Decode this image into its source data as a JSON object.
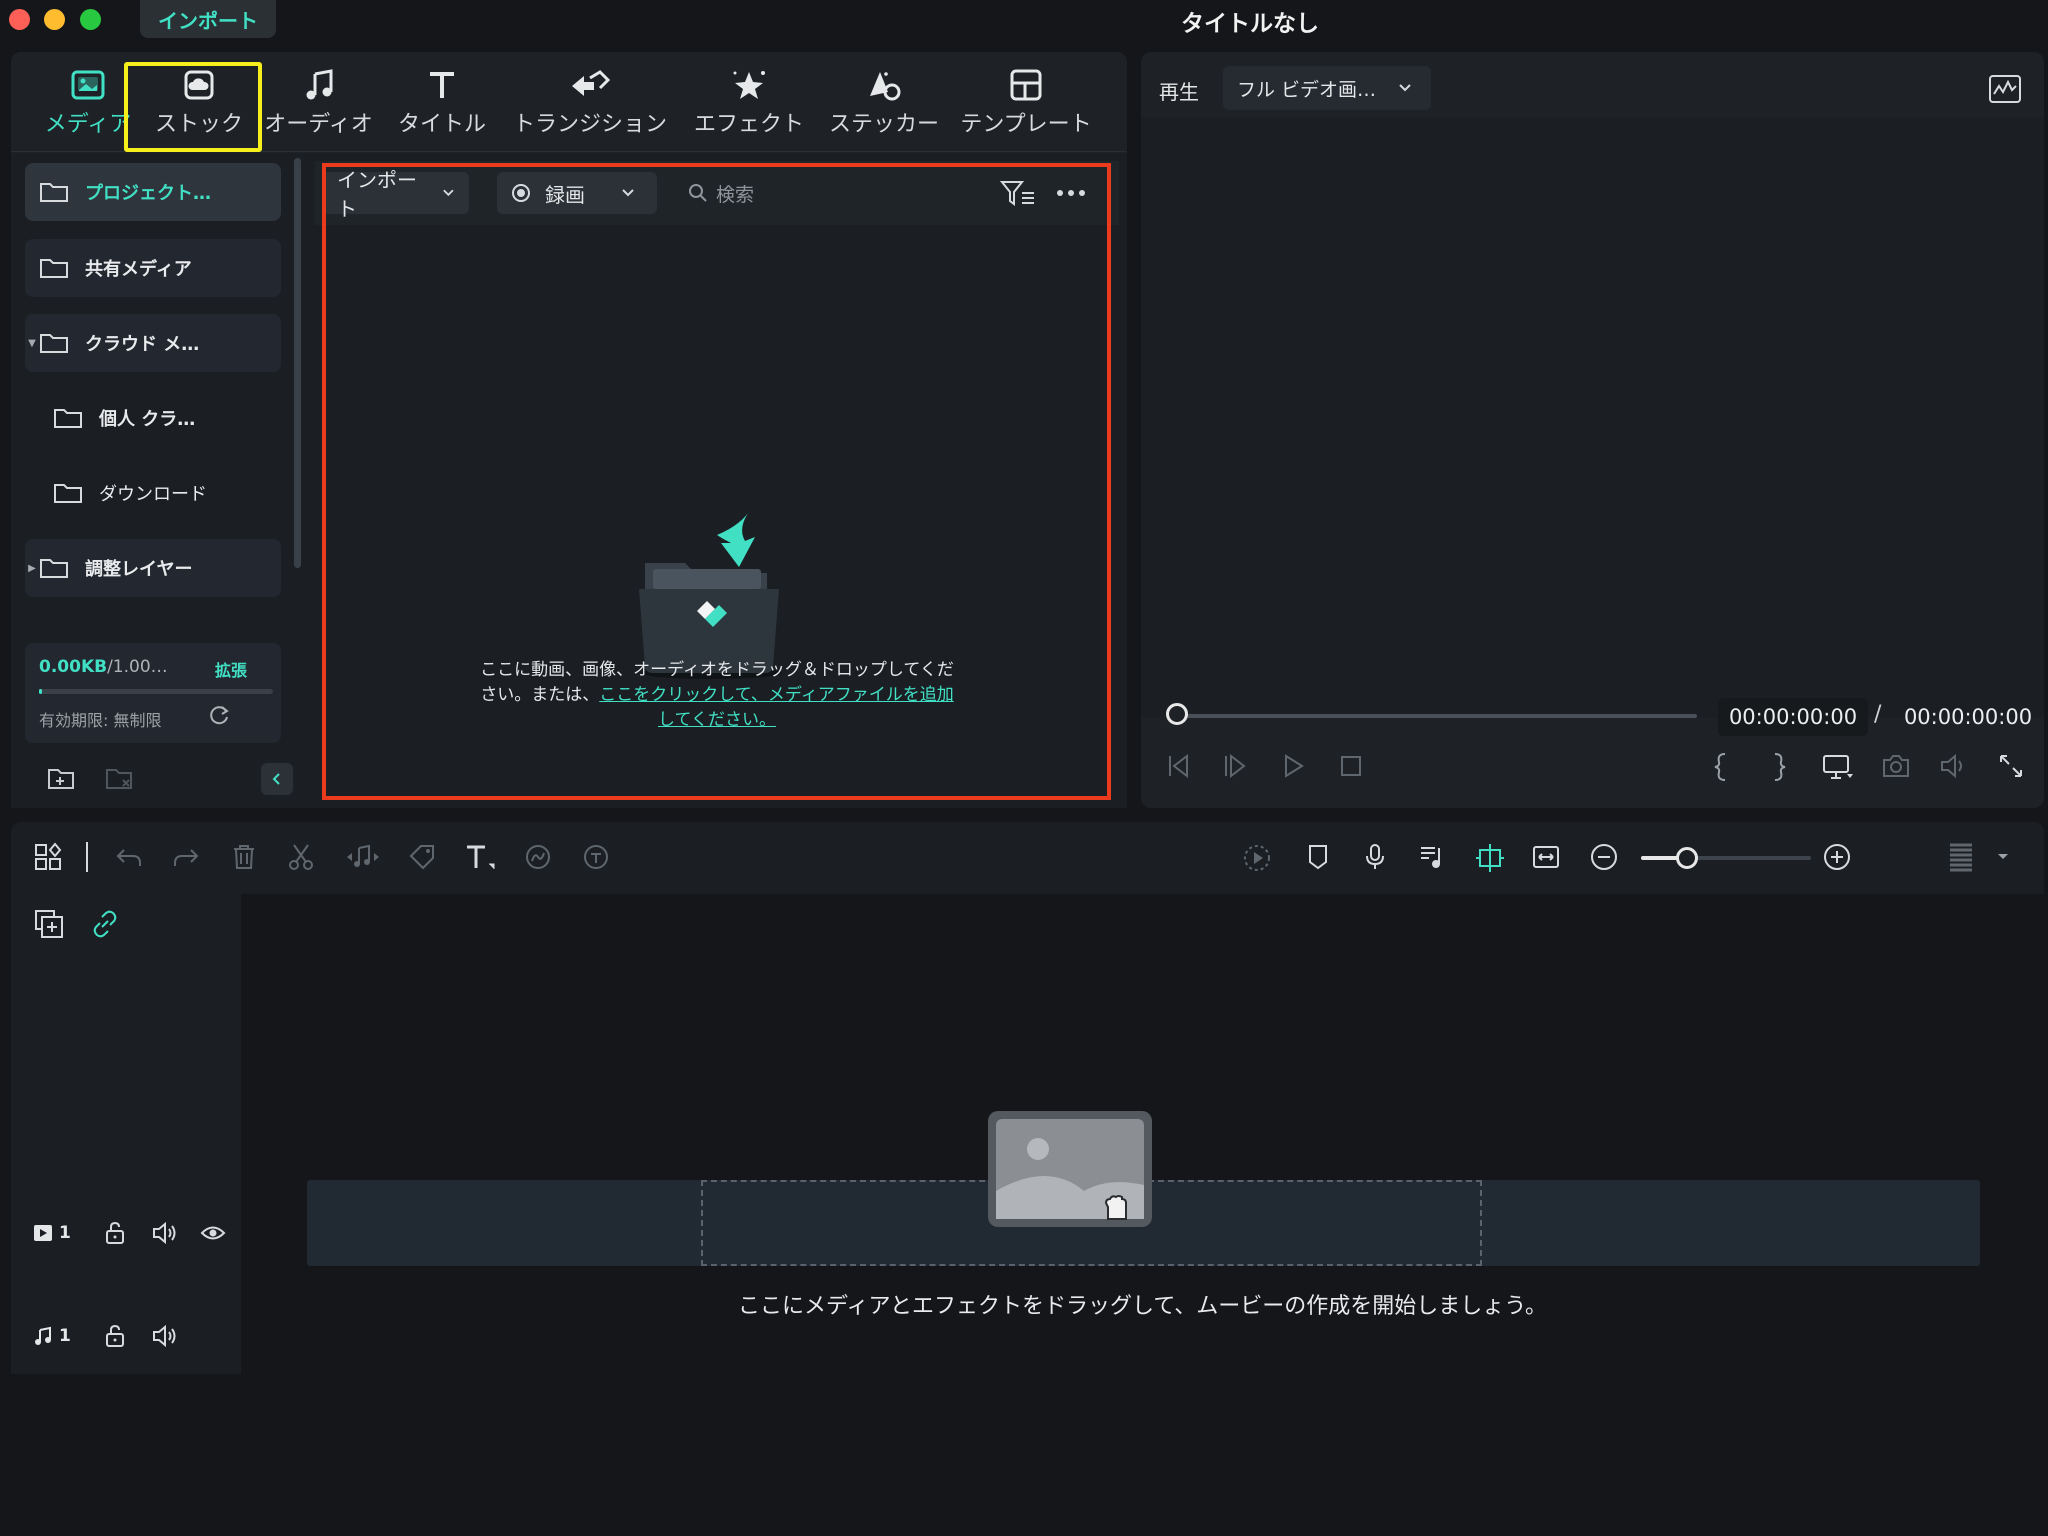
{
  "app": {
    "window_title": "タイトルなし",
    "active_top_tab": "インポート"
  },
  "library_tabs": [
    {
      "label": "メディア",
      "icon": "media-icon",
      "active": true
    },
    {
      "label": "ストック",
      "icon": "stock-cloud-icon",
      "active": false,
      "highlighted": true
    },
    {
      "label": "オーディオ",
      "icon": "music-note-icon",
      "active": false
    },
    {
      "label": "タイトル",
      "icon": "title-t-icon",
      "active": false
    },
    {
      "label": "トランジション",
      "icon": "transition-icon",
      "active": false
    },
    {
      "label": "エフェクト",
      "icon": "effect-star-icon",
      "active": false
    },
    {
      "label": "ステッカー",
      "icon": "sticker-icon",
      "active": false
    },
    {
      "label": "テンプレート",
      "icon": "template-icon",
      "active": false
    }
  ],
  "sidebar": {
    "items": [
      {
        "label": "プロジェクト…",
        "active": true
      },
      {
        "label": "共有メディア"
      },
      {
        "label": "クラウド メ…",
        "expanded": true
      },
      {
        "label": "個人 クラ…",
        "child": true
      },
      {
        "label": "ダウンロード",
        "child": true
      },
      {
        "label": "調整レイヤー",
        "collapsed": true
      }
    ],
    "storage": {
      "used": "0.00KB",
      "total": "/1.00…",
      "expand": "拡張",
      "expiry": "有効期限: 無制限",
      "fill_fraction": 0.01
    }
  },
  "media": {
    "import_label": "インポート",
    "record_label": "録画",
    "search_placeholder": "検索",
    "drop_text": "ここに動画、画像、オーディオをドラッグ＆ドロップしてください。または、",
    "drop_link": "ここをクリックして、メディアファイルを追加してください。"
  },
  "preview": {
    "play_label": "再生",
    "quality": "フル ビデオ画…",
    "time_current": "00:00:00:00",
    "time_separator": "/",
    "time_total": "00:00:00:00"
  },
  "timeline": {
    "hint": "ここにメディアとエフェクトをドラッグして、ムービーの作成を開始しましょう。",
    "video_track_label": "1",
    "audio_track_label": "1"
  },
  "colors": {
    "accent": "#41e0c5",
    "highlight_yellow": "#f6ef1b",
    "highlight_red": "#ec3b1c",
    "background": "#141619",
    "panel": "#1e2226"
  }
}
